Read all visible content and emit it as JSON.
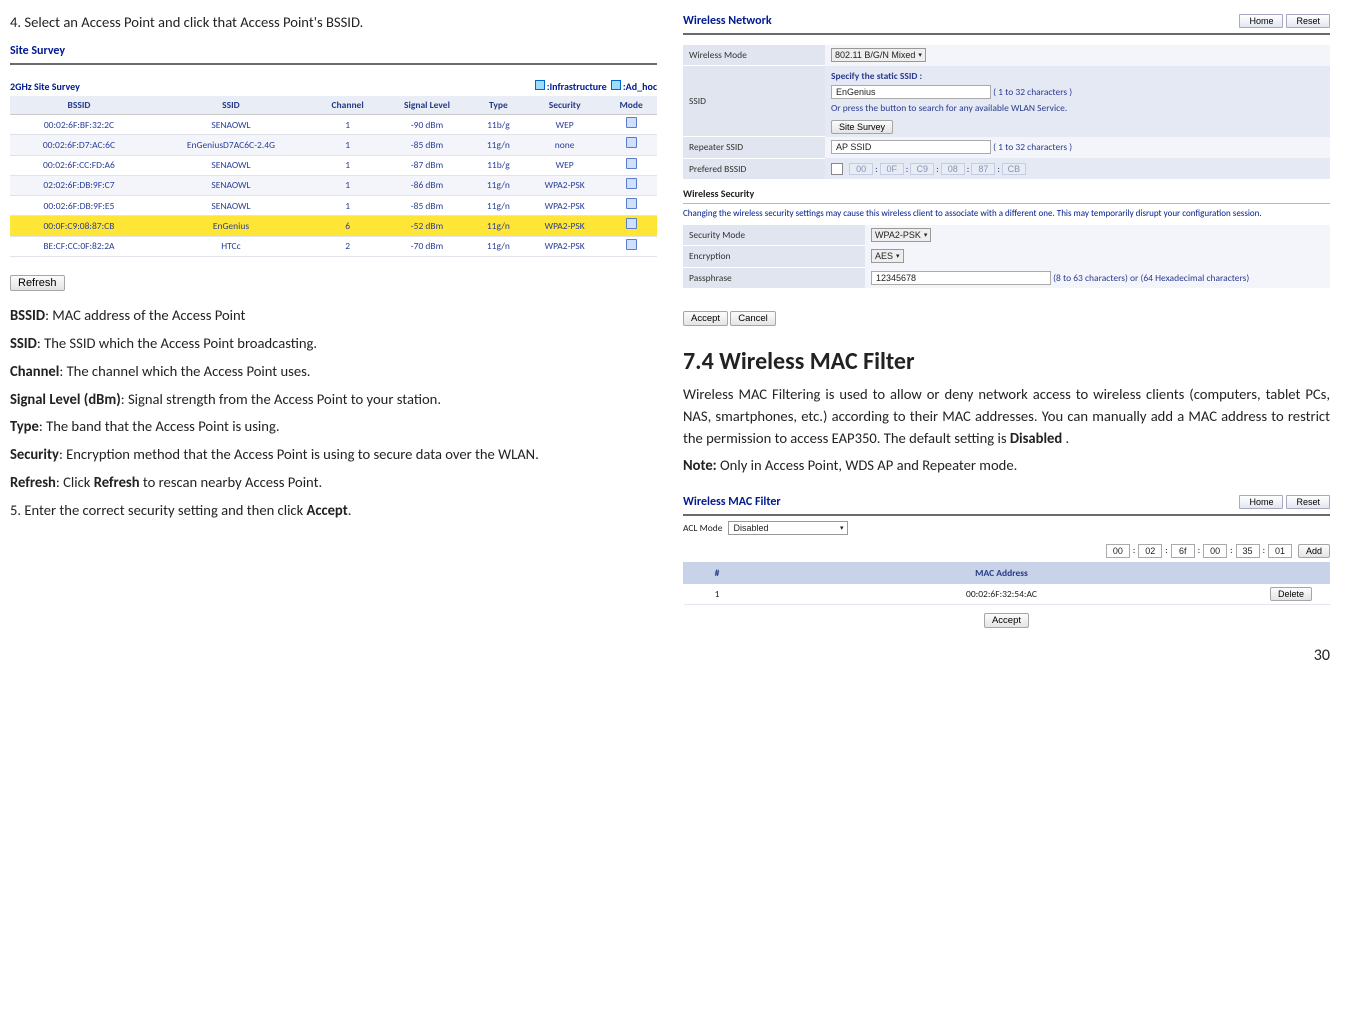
{
  "left": {
    "step4": "4. Select an Access Point and click that Access Point's BSSID.",
    "site_survey": {
      "title": "Site Survey",
      "band_label": "2GHz Site Survey",
      "legend_infra": ":Infrastructure",
      "legend_adhoc": ":Ad_hoc",
      "headers": [
        "BSSID",
        "SSID",
        "Channel",
        "Signal Level",
        "Type",
        "Security",
        "Mode"
      ],
      "rows": [
        {
          "bssid": "00:02:6F:BF:32:2C",
          "ssid": "SENAOWL",
          "ch": "1",
          "sig": "-90 dBm",
          "type": "11b/g",
          "sec": "WEP",
          "hi": false
        },
        {
          "bssid": "00:02:6F:D7:AC:6C",
          "ssid": "EnGeniusD7AC6C-2.4G",
          "ch": "1",
          "sig": "-85 dBm",
          "type": "11g/n",
          "sec": "none",
          "hi": false
        },
        {
          "bssid": "00:02:6F:CC:FD:A6",
          "ssid": "SENAOWL",
          "ch": "1",
          "sig": "-87 dBm",
          "type": "11b/g",
          "sec": "WEP",
          "hi": false
        },
        {
          "bssid": "02:02:6F:DB:9F:C7",
          "ssid": "SENAOWL",
          "ch": "1",
          "sig": "-86 dBm",
          "type": "11g/n",
          "sec": "WPA2-PSK",
          "hi": false
        },
        {
          "bssid": "00:02:6F:DB:9F:E5",
          "ssid": "SENAOWL",
          "ch": "1",
          "sig": "-85 dBm",
          "type": "11g/n",
          "sec": "WPA2-PSK",
          "hi": false
        },
        {
          "bssid": "00:0F:C9:08:87:CB",
          "ssid": "EnGenius",
          "ch": "6",
          "sig": "-52 dBm",
          "type": "11g/n",
          "sec": "WPA2-PSK",
          "hi": true
        },
        {
          "bssid": "BE:CF:CC:0F:82:2A",
          "ssid": "HTCc",
          "ch": "2",
          "sig": "-70 dBm",
          "type": "11g/n",
          "sec": "WPA2-PSK",
          "hi": false
        }
      ],
      "refresh": "Refresh"
    },
    "defs": {
      "bssid_t": "BSSID",
      "bssid_d": ": MAC address of the Access Point",
      "ssid_t": "SSID",
      "ssid_d": ": The SSID which the Access Point broadcasting.",
      "chan_t": "Channel",
      "chan_d": ": The channel which the Access Point uses.",
      "sig_t": "Signal Level (dBm)",
      "sig_d": ": Signal strength from the Access Point to your station.",
      "type_t": "Type",
      "type_d": ": The band that the Access Point is using.",
      "sec_t": "Security",
      "sec_d": ": Encryption method that the Access Point is using to secure data over the WLAN.",
      "ref_t": "Refresh",
      "ref_d1": ": Click ",
      "ref_b": "Refresh",
      "ref_d2": " to rescan nearby Access Point."
    },
    "step5a": "5. Enter the correct security setting and then click ",
    "step5b": "Accept",
    "step5c": "."
  },
  "right": {
    "wn": {
      "title": "Wireless Network",
      "home": "Home",
      "reset": "Reset",
      "mode_label": "Wireless Mode",
      "mode_value": "802.11 B/G/N Mixed",
      "ssid_label": "SSID",
      "ssid_spec": "Specify the static SSID :",
      "ssid_value": "EnGenius",
      "ssid_hint": "( 1 to 32 characters )",
      "ssid_or": "Or press the button to search for any available WLAN Service.",
      "site_survey_btn": "Site Survey",
      "rep_label": "Repeater SSID",
      "rep_value": "AP SSID",
      "rep_hint": "( 1 to 32 characters )",
      "pb_label": "Prefered BSSID",
      "pb_segs": [
        "00",
        "0F",
        "C9",
        "08",
        "87",
        "CB"
      ],
      "sec_title": "Wireless Security",
      "sec_warn": "Changing the wireless security settings may cause this wireless client to associate with a different one. This may temporarily disrupt your configuration session.",
      "sm_label": "Security Mode",
      "sm_value": "WPA2-PSK",
      "enc_label": "Encryption",
      "enc_value": "AES",
      "pass_label": "Passphrase",
      "pass_value": "12345678",
      "pass_hint": "(8 to 63 characters) or (64 Hexadecimal characters)",
      "accept": "Accept",
      "cancel": "Cancel"
    },
    "h2": "7.4   Wireless MAC Filter",
    "para_a": "Wireless MAC Filtering is used to allow or deny network access to wireless clients (computers, tablet PCs, NAS, smartphones, etc.) according to their MAC addresses. You can manually add a MAC address to restrict the permission to access EAP350. The default setting is ",
    "para_b": "Disabled",
    "para_c": " .",
    "note_t": "Note:",
    "note_d": " Only in Access Point, WDS AP and Repeater mode.",
    "mf": {
      "title": "Wireless MAC Filter",
      "home": "Home",
      "reset": "Reset",
      "acl_label": "ACL Mode",
      "acl_value": "Disabled",
      "mac_segs": [
        "00",
        "02",
        "6f",
        "00",
        "35",
        "01"
      ],
      "add": "Add",
      "th1": "#",
      "th2": "MAC Address",
      "row_no": "1",
      "row_mac": "00:02:6F:32:54:AC",
      "delete": "Delete",
      "accept": "Accept"
    }
  },
  "page_number": "30"
}
